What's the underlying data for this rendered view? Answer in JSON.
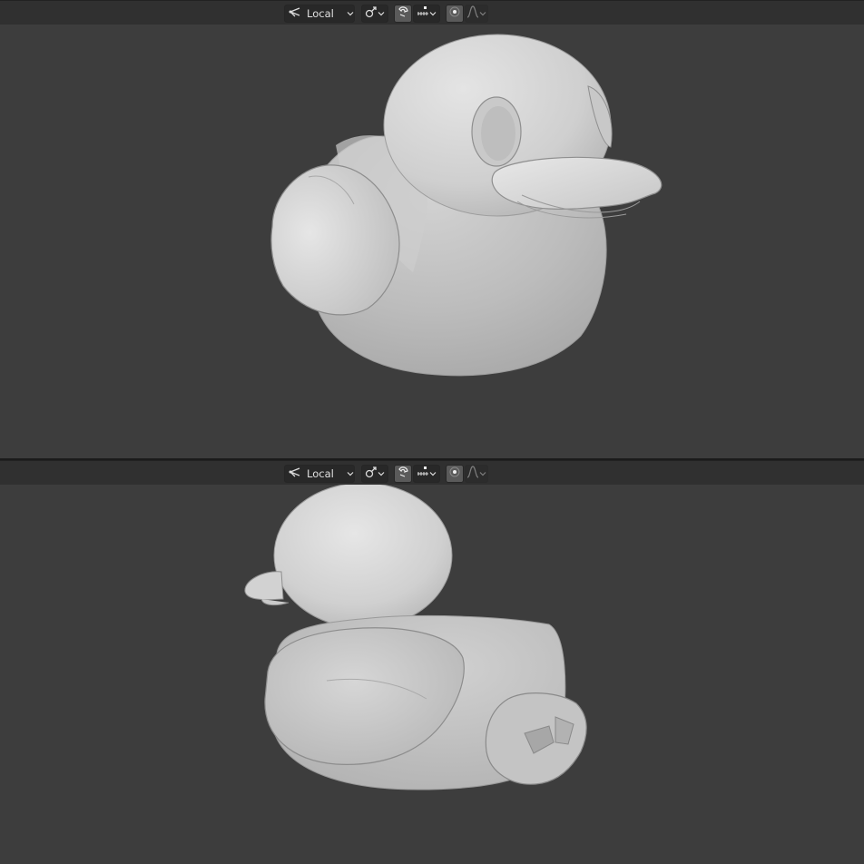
{
  "viewports": [
    {
      "id": "top",
      "toolbar": {
        "transform_orientation": {
          "icon": "orientation-gizmo-icon",
          "value": "Local"
        },
        "pivot_icon": "pivot-link-icon",
        "snap_icon": "snap-magnet-icon",
        "snap_target_icon": "snap-increment-icon",
        "proportional_icon": "proportional-edit-icon",
        "falloff_icon": "falloff-curve-icon"
      }
    },
    {
      "id": "bottom",
      "toolbar": {
        "transform_orientation": {
          "icon": "orientation-gizmo-icon",
          "value": "Local"
        },
        "pivot_icon": "pivot-link-icon",
        "snap_icon": "snap-magnet-icon",
        "snap_target_icon": "snap-increment-icon",
        "proportional_icon": "proportional-edit-icon",
        "falloff_icon": "falloff-curve-icon"
      }
    }
  ],
  "colors": {
    "viewport_bg": "#3d3d3d",
    "header_bg": "#303030",
    "model_light": "#d6d6d6",
    "model_mid": "#bdbdbd",
    "model_shadow": "#a8a8a8",
    "outline": "#8a8a8a"
  }
}
